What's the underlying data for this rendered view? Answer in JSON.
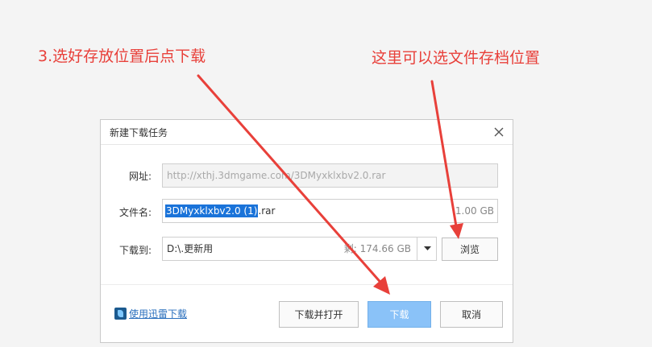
{
  "annotations": {
    "left": "3.选好存放位置后点下载",
    "right": "这里可以选文件存档位置"
  },
  "dialog": {
    "title": "新建下载任务",
    "url_label": "网址:",
    "url_value": "http://xthj.3dmgame.com/3DMyxklxbv2.0.rar",
    "filename_label": "文件名:",
    "filename_selected": "3DMyxklxbv2.0 (1)",
    "filename_ext": ".rar",
    "file_size": "1.00 GB",
    "saveto_label": "下载到:",
    "saveto_value": "D:\\.更新用",
    "free_space": "剩: 174.66 GB",
    "browse_label": "浏览",
    "xunlei_link": "使用迅雷下载",
    "open_label": "下载并打开",
    "download_label": "下载",
    "cancel_label": "取消"
  },
  "colors": {
    "annotation": "#e8403a",
    "primary_button": "#8ac2f8",
    "selection": "#1a73d9"
  }
}
